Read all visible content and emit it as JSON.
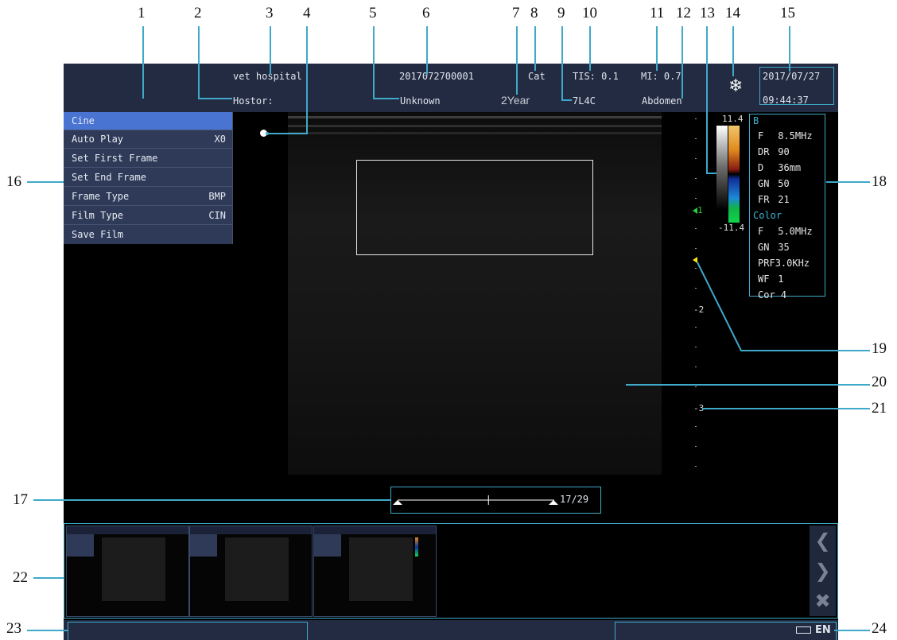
{
  "callouts": [
    "1",
    "2",
    "3",
    "4",
    "5",
    "6",
    "7",
    "8",
    "9",
    "10",
    "11",
    "12",
    "13",
    "14",
    "15",
    "16",
    "17",
    "18",
    "19",
    "20",
    "21",
    "22",
    "23",
    "24"
  ],
  "header": {
    "hospital": "vet hospital",
    "hostor_label": "Hostor:",
    "patient_id": "2017072700001",
    "gender": "Unknown",
    "age": "2Year",
    "species": "Cat",
    "probe": "7L4C",
    "tis": "TIS: 0.1",
    "mi": "MI: 0.7",
    "exam": "Abdomen",
    "freeze_icon": "snowflake-icon",
    "date": "2017/07/27",
    "time": "09:44:37"
  },
  "cine_menu": {
    "items": [
      {
        "label": "Cine",
        "value": ""
      },
      {
        "label": "Auto Play",
        "value": "X0"
      },
      {
        "label": "Set First Frame",
        "value": ""
      },
      {
        "label": "Set End Frame",
        "value": ""
      },
      {
        "label": "Frame Type",
        "value": "BMP"
      },
      {
        "label": "Film Type",
        "value": "CIN"
      },
      {
        "label": "Save Film",
        "value": ""
      }
    ]
  },
  "depth_scale": {
    "labels": [
      "1",
      "-2",
      "-3"
    ],
    "focus_color": "#f5e616",
    "marker_color": "#2ecc40"
  },
  "color_bar": {
    "max": "11.4",
    "min": "-11.4"
  },
  "params": {
    "b_title": "B",
    "b": [
      {
        "k": "F",
        "v": "8.5MHz"
      },
      {
        "k": "DR",
        "v": "90"
      },
      {
        "k": "D",
        "v": "36mm"
      },
      {
        "k": "GN",
        "v": "50"
      },
      {
        "k": "FR",
        "v": "21"
      }
    ],
    "color_title": "Color",
    "color": [
      {
        "k": "F",
        "v": "5.0MHz"
      },
      {
        "k": "GN",
        "v": "35"
      },
      {
        "k": "PRF",
        "v": "3.0KHz"
      },
      {
        "k": "WF",
        "v": "1"
      },
      {
        "k": "Cor",
        "v": "4"
      }
    ]
  },
  "cine": {
    "frame": "17/29",
    "position": 0.58
  },
  "status": {
    "language": "EN",
    "battery_icon": "battery-icon"
  },
  "thumb_nav": {
    "prev_icon": "chevron-left-icon",
    "next_icon": "chevron-right-icon",
    "delete_icon": "close-icon"
  },
  "colors": {
    "accent": "#3fa9c9",
    "bar": "#232b42",
    "menu": "#2f3a58",
    "menu_selected": "#4a74d2"
  }
}
